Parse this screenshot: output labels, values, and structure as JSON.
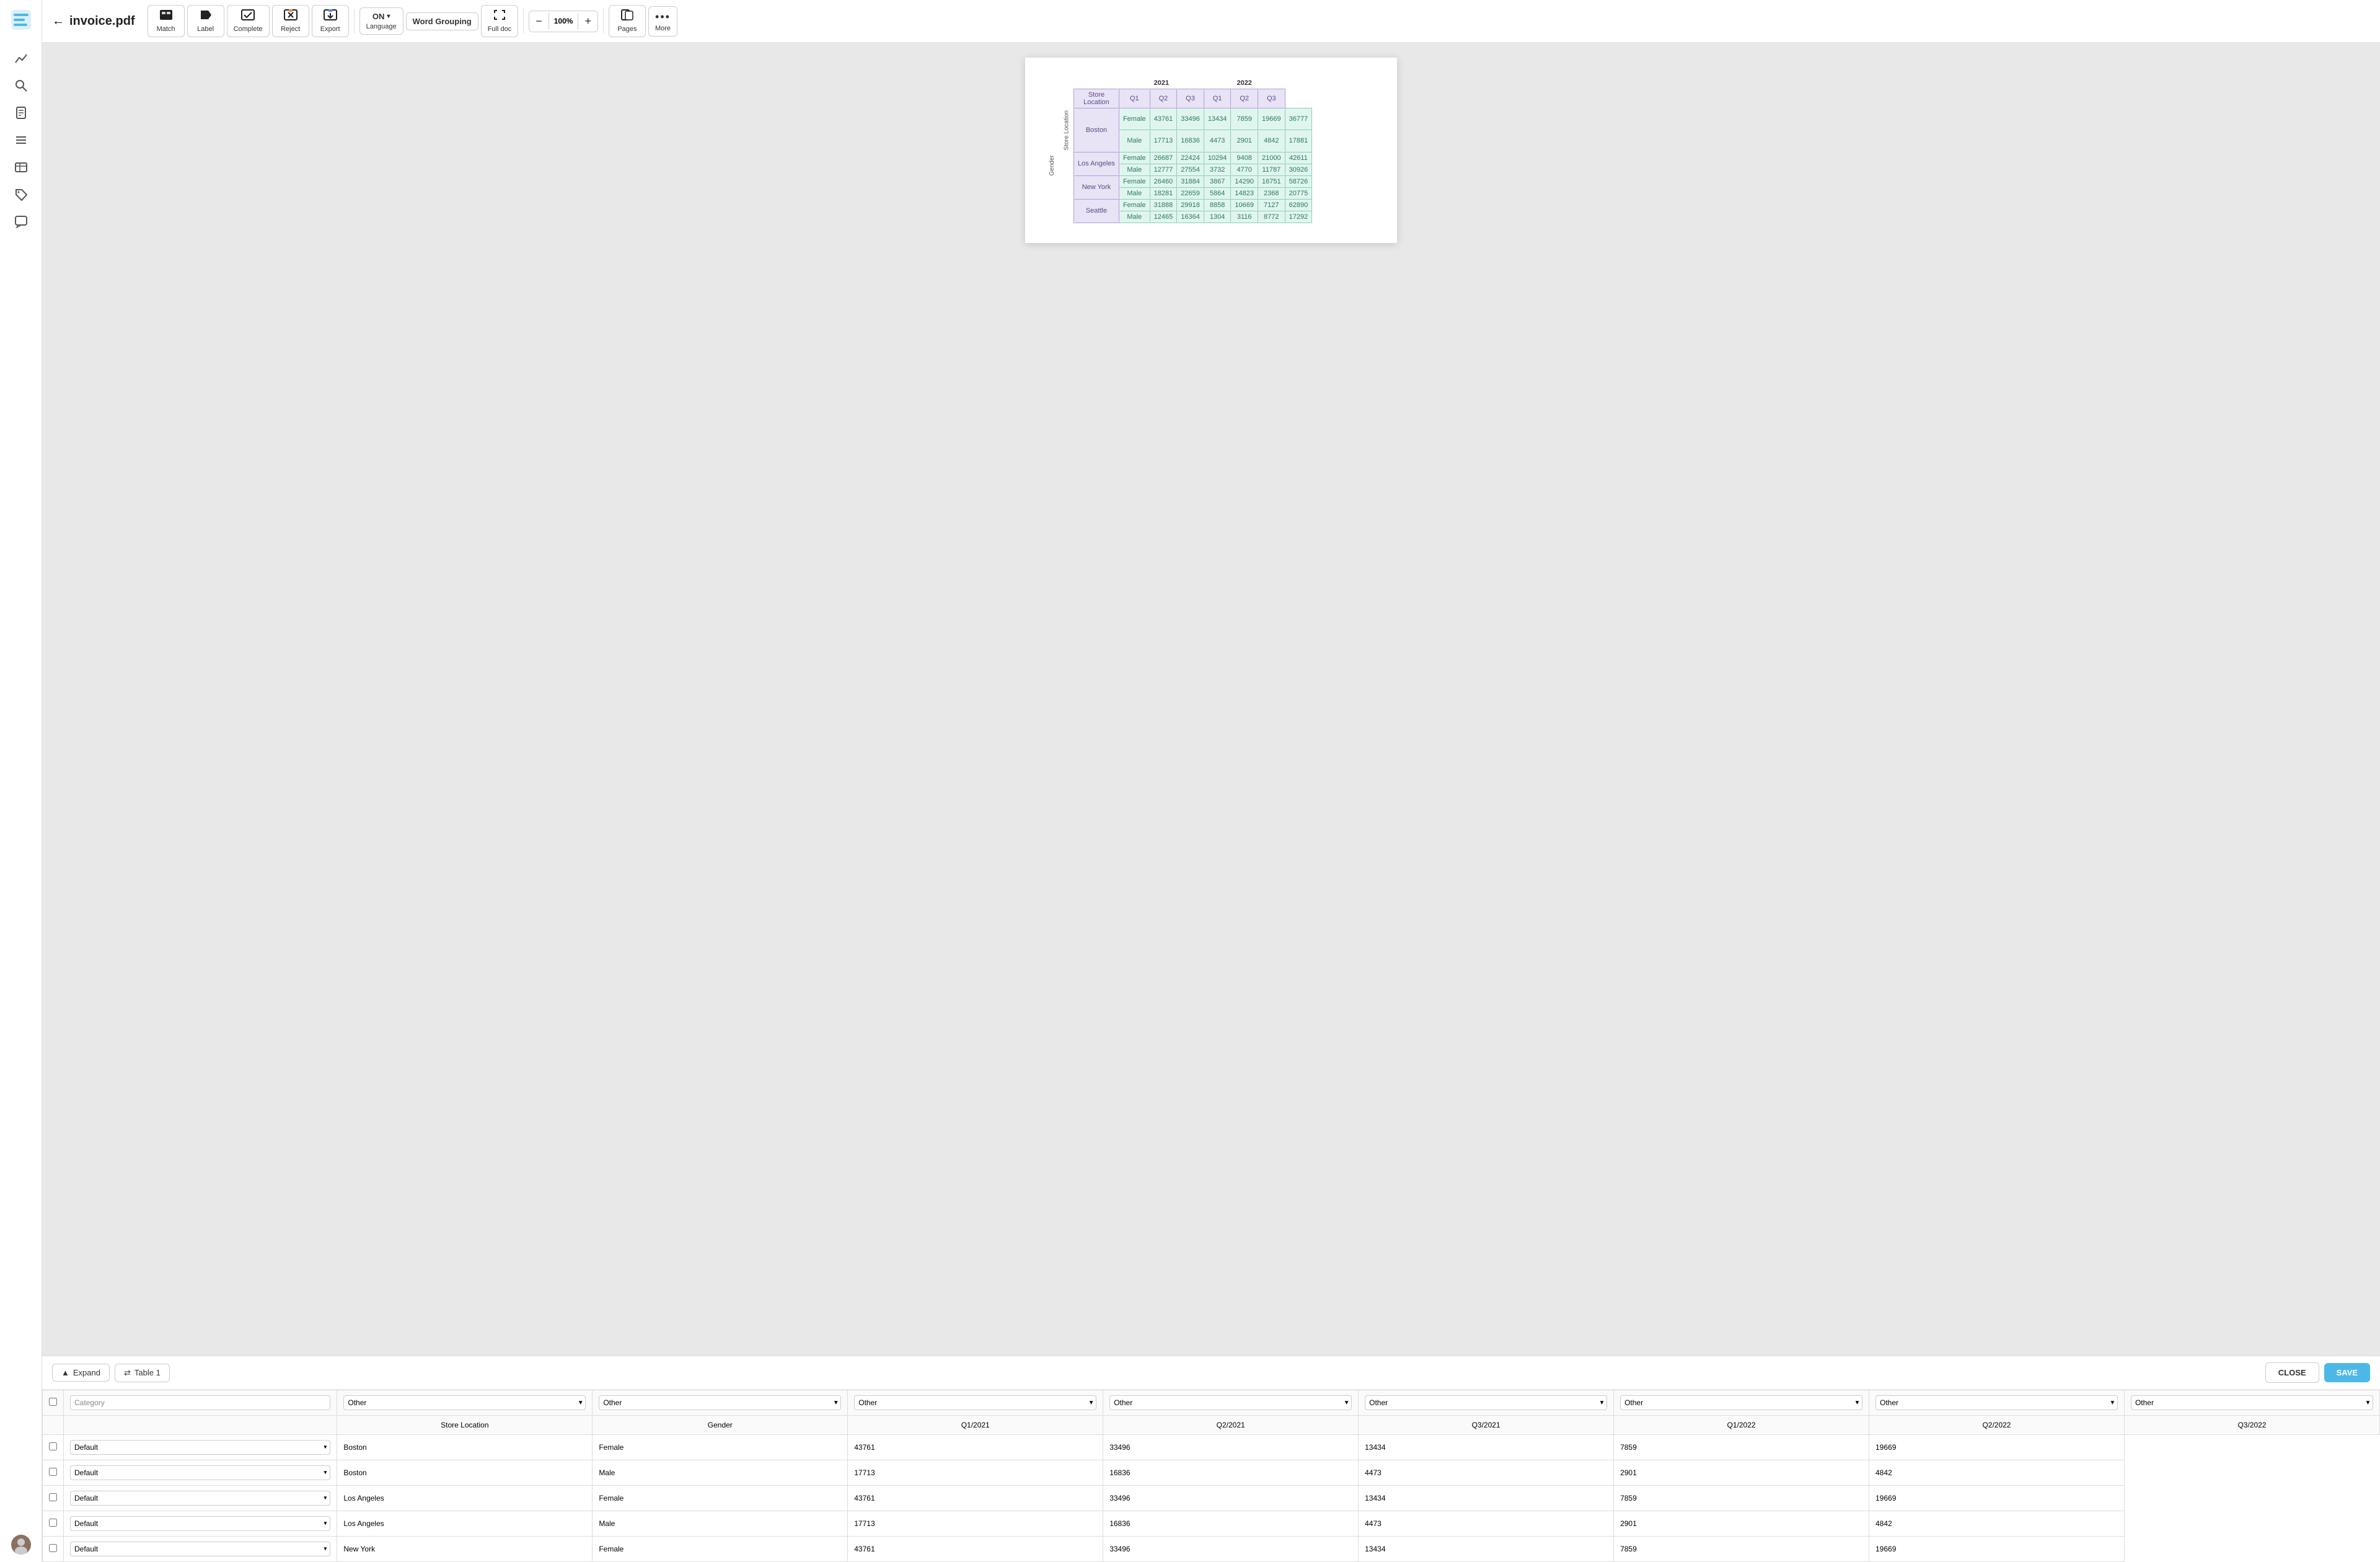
{
  "app": {
    "logo_text": "📄",
    "title": "invoice.pdf"
  },
  "sidebar": {
    "icons": [
      {
        "name": "chart-icon",
        "glyph": "📈",
        "label": "Analytics"
      },
      {
        "name": "search-icon",
        "glyph": "🔍",
        "label": "Search"
      },
      {
        "name": "document-icon",
        "glyph": "📋",
        "label": "Document"
      },
      {
        "name": "list-icon",
        "glyph": "☰",
        "label": "List"
      },
      {
        "name": "table-icon",
        "glyph": "▬",
        "label": "Table"
      },
      {
        "name": "tag-icon",
        "glyph": "🏷",
        "label": "Tag"
      },
      {
        "name": "comment-icon",
        "glyph": "💬",
        "label": "Comment"
      }
    ]
  },
  "toolbar": {
    "back_label": "←",
    "match_label": "Match",
    "label_label": "Label",
    "complete_label": "Complete",
    "reject_label": "Reject",
    "export_label": "Export",
    "language_label": "Language",
    "language_value": "ON",
    "word_grouping_label": "Word Grouping",
    "full_doc_label": "Full doc",
    "zoom_label": "Zoom",
    "zoom_value": "100",
    "zoom_unit": "%",
    "pages_label": "Pages",
    "more_label": "More"
  },
  "document": {
    "table": {
      "year_2021": "2021",
      "year_2022": "2022",
      "headers": [
        "Store Location",
        "Gender",
        "Q1",
        "Q2",
        "Q3",
        "Q1",
        "Q2",
        "Q3"
      ],
      "row_label_gender": "Gender",
      "row_label_store": "Store Location",
      "cities": [
        {
          "name": "Boston",
          "rows": [
            {
              "gender": "Female",
              "q1_2021": "43761",
              "q2_2021": "33496",
              "q3_2021": "13434",
              "q1_2022": "7859",
              "q2_2022": "19669",
              "q3_2022": "36777"
            },
            {
              "gender": "Male",
              "q1_2021": "17713",
              "q2_2021": "16836",
              "q3_2021": "4473",
              "q1_2022": "2901",
              "q2_2022": "4842",
              "q3_2022": "17881"
            }
          ]
        },
        {
          "name": "Los Angeles",
          "rows": [
            {
              "gender": "Female",
              "q1_2021": "26687",
              "q2_2021": "22424",
              "q3_2021": "10294",
              "q1_2022": "9408",
              "q2_2022": "21000",
              "q3_2022": "42611"
            },
            {
              "gender": "Male",
              "q1_2021": "12777",
              "q2_2021": "27554",
              "q3_2021": "3732",
              "q1_2022": "4770",
              "q2_2022": "11787",
              "q3_2022": "30926"
            }
          ]
        },
        {
          "name": "New York",
          "rows": [
            {
              "gender": "Female",
              "q1_2021": "26460",
              "q2_2021": "31884",
              "q3_2021": "3867",
              "q1_2022": "14290",
              "q2_2022": "16751",
              "q3_2022": "58726"
            },
            {
              "gender": "Male",
              "q1_2021": "18281",
              "q2_2021": "22659",
              "q3_2021": "5864",
              "q1_2022": "14823",
              "q2_2022": "2368",
              "q3_2022": "20775"
            }
          ]
        },
        {
          "name": "Seattle",
          "rows": [
            {
              "gender": "Female",
              "q1_2021": "31888",
              "q2_2021": "29918",
              "q3_2021": "8858",
              "q1_2022": "10669",
              "q2_2022": "7127",
              "q3_2022": "62890"
            },
            {
              "gender": "Male",
              "q1_2021": "12465",
              "q2_2021": "16364",
              "q3_2021": "1304",
              "q1_2022": "3116",
              "q2_2022": "8772",
              "q3_2022": "17292"
            }
          ]
        }
      ]
    }
  },
  "bottom_panel": {
    "expand_label": "Expand",
    "table_label": "Table 1",
    "close_label": "CLOSE",
    "save_label": "SAVE",
    "category_placeholder": "Category",
    "column_headers": {
      "other_options": [
        "Other",
        "Store Location",
        "Gender",
        "Q1/2021",
        "Q2/2021",
        "Q3/2021",
        "Q1/2022",
        "Q2/2022",
        "Q3/2022"
      ]
    },
    "col_labels": [
      "Other",
      "Other",
      "Other",
      "Other",
      "Other",
      "Other",
      "Other",
      "Other"
    ],
    "col_sublabels": [
      "Store Location",
      "Gender",
      "Q1/2021",
      "Q2/2021",
      "Q3/2021",
      "Q1/2022",
      "Q2/2022",
      "Q3/2022"
    ],
    "category_options": [
      "Default",
      "Other"
    ],
    "rows": [
      {
        "id": 1,
        "category": "Default",
        "store_location": "Boston",
        "gender": "Female",
        "q1_2021": "43761",
        "q2_2021": "33496",
        "q3_2021": "13434",
        "q1_2022": "7859",
        "q2_2022": "19669"
      },
      {
        "id": 2,
        "category": "Default",
        "store_location": "Boston",
        "gender": "Male",
        "q1_2021": "17713",
        "q2_2021": "16836",
        "q3_2021": "4473",
        "q1_2022": "2901",
        "q2_2022": "4842"
      },
      {
        "id": 3,
        "category": "Default",
        "store_location": "Los Angeles",
        "gender": "Female",
        "q1_2021": "43761",
        "q2_2021": "33496",
        "q3_2021": "13434",
        "q1_2022": "7859",
        "q2_2022": "19669"
      },
      {
        "id": 4,
        "category": "Default",
        "store_location": "Los Angeles",
        "gender": "Male",
        "q1_2021": "17713",
        "q2_2021": "16836",
        "q3_2021": "4473",
        "q1_2022": "2901",
        "q2_2022": "4842"
      },
      {
        "id": 5,
        "category": "Default",
        "store_location": "New York",
        "gender": "Female",
        "q1_2021": "43761",
        "q2_2021": "33496",
        "q3_2021": "13434",
        "q1_2022": "7859",
        "q2_2022": "19669"
      }
    ]
  }
}
